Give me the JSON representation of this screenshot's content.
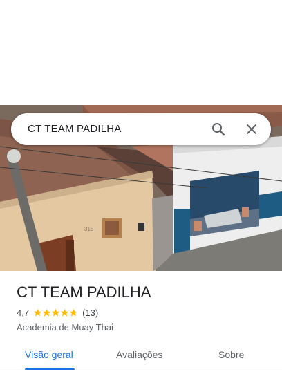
{
  "search": {
    "query": "CT TEAM PADILHA"
  },
  "place": {
    "name": "CT TEAM PADILHA",
    "rating": "4,7",
    "rating_stars": 4.7,
    "review_count": "(13)",
    "category": "Academia de Muay Thai",
    "star_color": "#fbbc04"
  },
  "tabs": [
    {
      "label": "Visão geral",
      "active": true
    },
    {
      "label": "Avaliações",
      "active": false
    },
    {
      "label": "Sobre",
      "active": false
    }
  ],
  "colors": {
    "accent": "#1a73e8"
  },
  "photo": {
    "house_number": "315"
  }
}
